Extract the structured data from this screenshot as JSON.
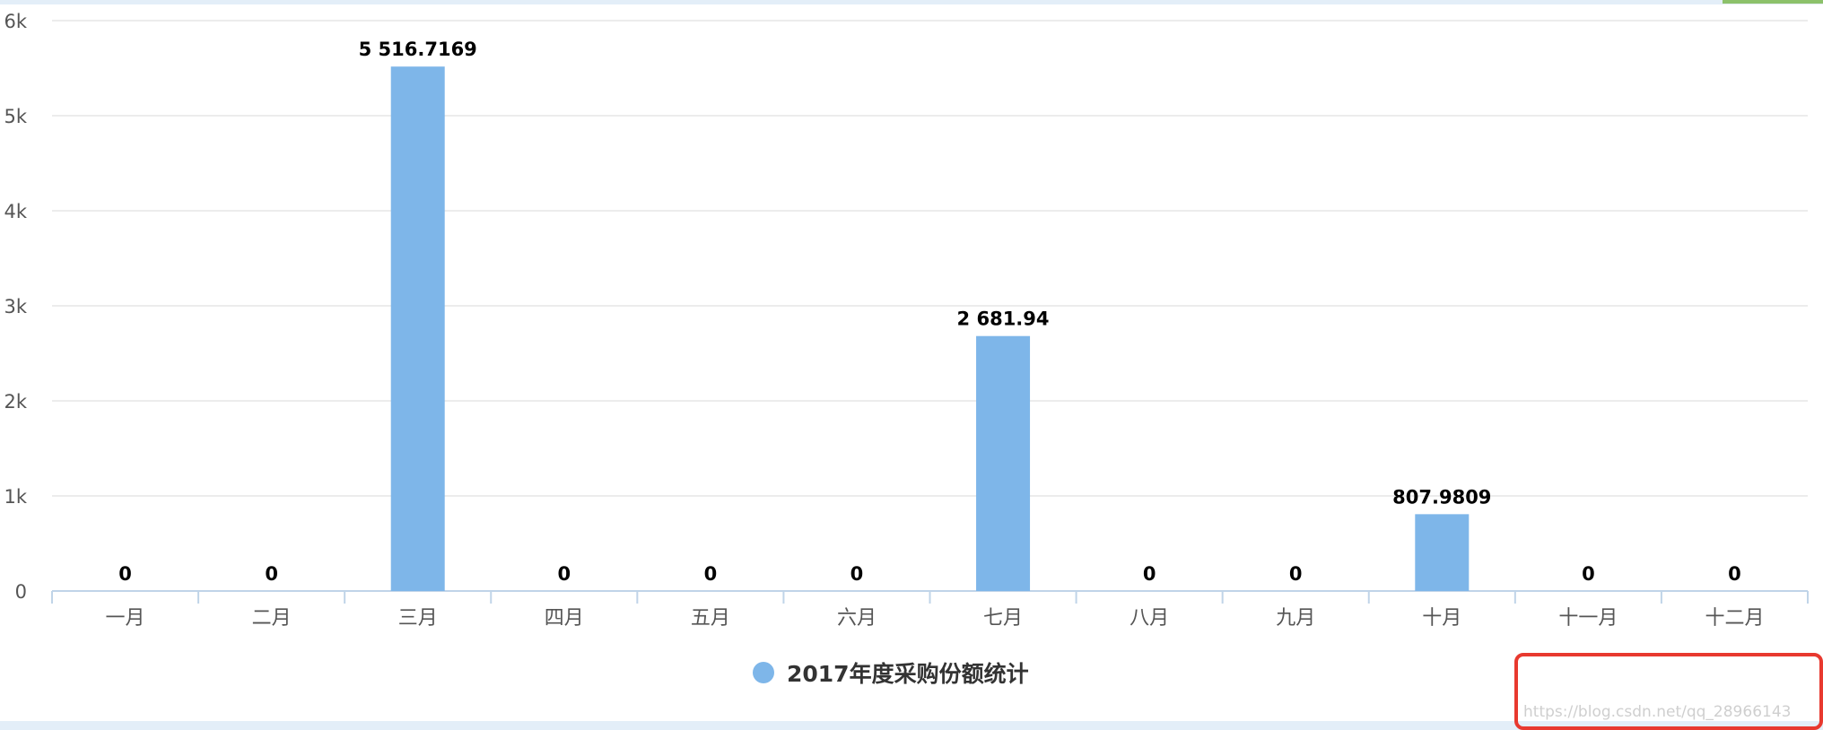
{
  "chart_data": {
    "type": "bar",
    "categories": [
      "一月",
      "二月",
      "三月",
      "四月",
      "五月",
      "六月",
      "七月",
      "八月",
      "九月",
      "十月",
      "十一月",
      "十二月"
    ],
    "series": [
      {
        "name": "2017年度采购份额统计",
        "values": [
          0,
          0,
          5516.7169,
          0,
          0,
          0,
          2681.94,
          0,
          0,
          807.9809,
          0,
          0
        ],
        "data_labels": [
          "0",
          "0",
          "5 516.7169",
          "0",
          "0",
          "0",
          "2 681.94",
          "0",
          "0",
          "807.9809",
          "0",
          "0"
        ]
      }
    ],
    "y_ticks": [
      "0",
      "1k",
      "2k",
      "3k",
      "4k",
      "5k",
      "6k"
    ],
    "ylim": [
      0,
      6000
    ],
    "grid": true,
    "legend": "bottom-center",
    "bar_color": "#7eb6e9",
    "grid_color": "#e6e6e6",
    "axis_color": "#c0d4e8"
  },
  "watermark": {
    "text": "https://blog.csdn.net/qq_28966143",
    "box_color": "#e8392f"
  },
  "frame": {
    "accent_top_right": "#8cc16a",
    "border_color": "#e3eef8"
  }
}
